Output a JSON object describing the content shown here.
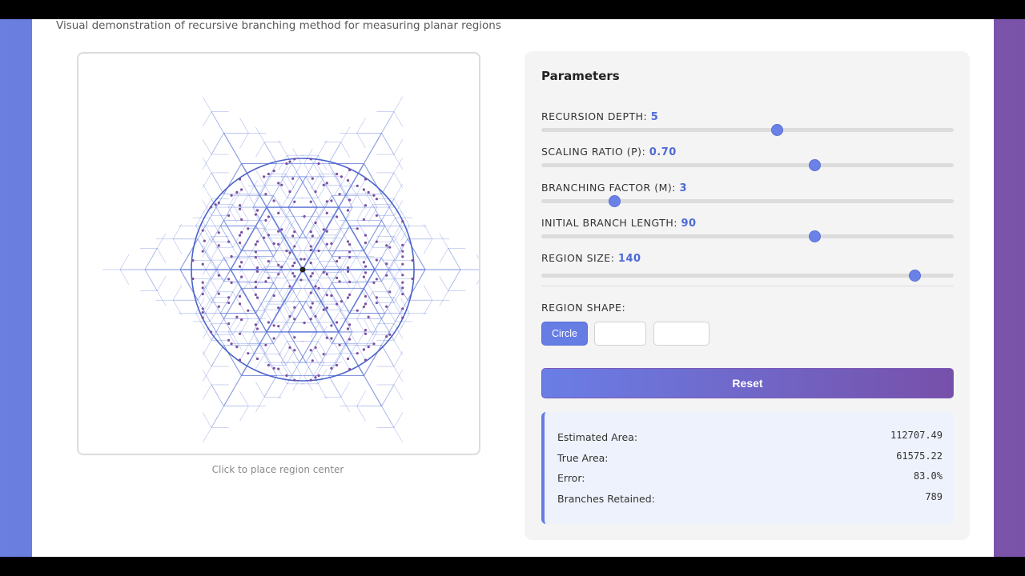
{
  "header": {
    "subtitle": "Visual demonstration of recursive branching method for measuring planar regions"
  },
  "canvas": {
    "hint": "Click to place region center"
  },
  "panel": {
    "title": "Parameters",
    "params": [
      {
        "label": "RECURSION DEPTH:",
        "value": "5",
        "fraction": 0.57
      },
      {
        "label": "SCALING RATIO (P):",
        "value": "0.70",
        "fraction": 0.663
      },
      {
        "label": "BRANCHING FACTOR (M):",
        "value": "3",
        "fraction": 0.176
      },
      {
        "label": "INITIAL BRANCH LENGTH:",
        "value": "90",
        "fraction": 0.663
      },
      {
        "label": "REGION SIZE:",
        "value": "140",
        "fraction": 0.905
      }
    ],
    "shape_label": "REGION SHAPE:",
    "shapes": [
      {
        "label": "Circle",
        "active": true
      },
      {
        "label": "",
        "active": false
      },
      {
        "label": "",
        "active": false
      }
    ],
    "reset_label": "Reset",
    "results": [
      {
        "key": "Estimated Area:",
        "value": "112707.49"
      },
      {
        "key": "True Area:",
        "value": "61575.22"
      },
      {
        "key": "Error:",
        "value": "83.0%"
      },
      {
        "key": "Branches Retained:",
        "value": "789"
      }
    ]
  },
  "colors": {
    "accent": "#667de4",
    "branch": "#5b74d6",
    "point": "#7a4fa0",
    "region": "#4a63c9"
  }
}
